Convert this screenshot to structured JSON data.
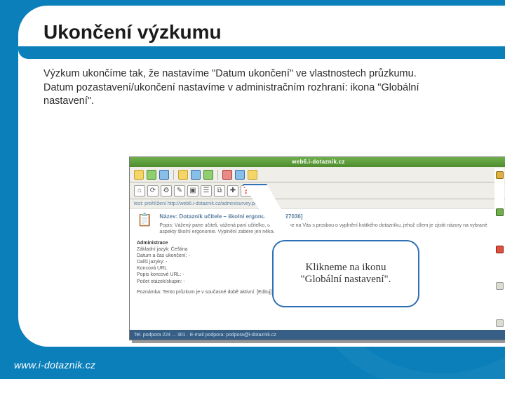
{
  "title": "Ukončení výzkumu",
  "body_p1": "Výzkum ukončíme tak, že nastavíme \"Datum ukončení\" ve vlastnostech průzkumu.",
  "body_p2": "Datum pozastavení/ukončení nastavíme v administračním rozhraní: ikona \"Globální nastavení\".",
  "callout_line1": "Klikneme na ikonu",
  "callout_line2": "\"Globální nastavení\".",
  "footer_url": "www.i-dotaznik.cz",
  "screenshot": {
    "titlebar": "web6.i-dotaznik.cz",
    "toolbar_icons": [
      "y",
      "g",
      "b",
      "y",
      "b",
      "g",
      "r",
      "b",
      "y"
    ],
    "toolbar2_glyphs": [
      "⌂",
      "⟳",
      "⚙",
      "✎",
      "▣",
      "☰",
      "⧉",
      "✚",
      "❓"
    ],
    "crumb": "test: prohlížení    http://web6.i-dotaznik.cz/admin/survey.php?sid=...",
    "panel_title": "Název: Dotazník učitele – školní ergonomie [ID 27036]",
    "panel_body": "Popis: Vážený pane učiteli, vážená paní učitelko, obracíme se na Vás s prosbou o vyplnění krátkého dotazníku, jehož cílem je zjistit názory na vybrané aspekty školní ergonomie. Vyplnění zabere jen několik minut.",
    "side_heading": "Administrace",
    "side_items": [
      "Základní jazyk: Čeština",
      "Datum a čas ukončení: -",
      "Další jazyky: -",
      "Koncová URL",
      "Popis koncové URL: -",
      "Počet otázek/skupin: -"
    ],
    "side_tail": "Poznámka: Tento průzkum je v současné době aktivní. [Edituj]",
    "footer": "Tel. podpora 224 ... 301  ·  E-mail podpora: podpora@i-dotaznik.cz"
  }
}
